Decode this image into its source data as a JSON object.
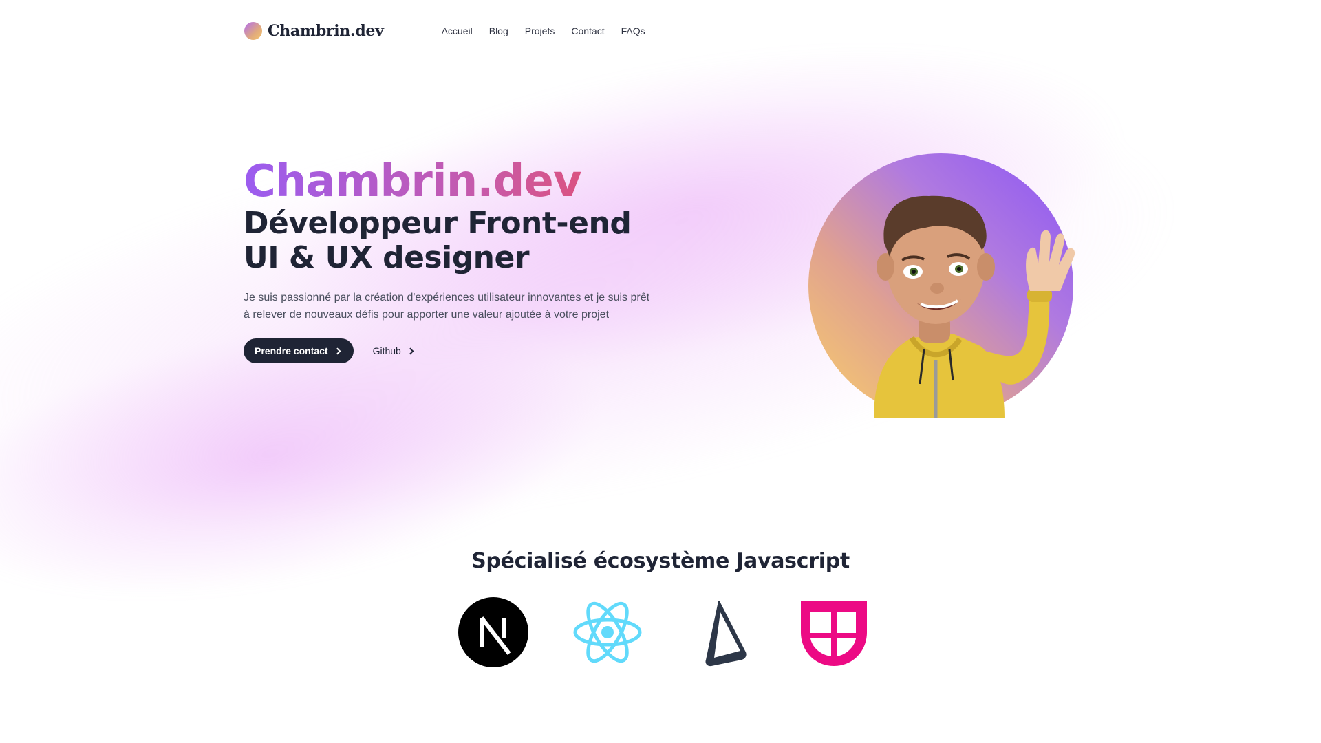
{
  "header": {
    "logo_text": "Chambrin.dev",
    "nav": [
      {
        "label": "Accueil"
      },
      {
        "label": "Blog"
      },
      {
        "label": "Projets"
      },
      {
        "label": "Contact"
      },
      {
        "label": "FAQs"
      }
    ]
  },
  "hero": {
    "brand": "Chambrin.dev",
    "role_line_1": "Développeur Front-end",
    "role_line_2": "UI & UX designer",
    "description": "Je suis passionné par la création d'expériences utilisateur innovantes et je suis prêt à relever de nouveaux défis pour apporter une valeur ajoutée à votre projet",
    "primary_button": "Prendre contact",
    "secondary_button": "Github"
  },
  "skills": {
    "title": "Spécialisé écosystème Javascript",
    "icons": [
      "nextjs-icon",
      "react-icon",
      "prisma-icon",
      "sanity-icon"
    ]
  },
  "colors": {
    "dark": "#1f2435",
    "brand_gradient_start": "#9b5cf0",
    "brand_gradient_end": "#ee4a58",
    "react": "#61dafb",
    "sanity": "#ec0a84"
  }
}
